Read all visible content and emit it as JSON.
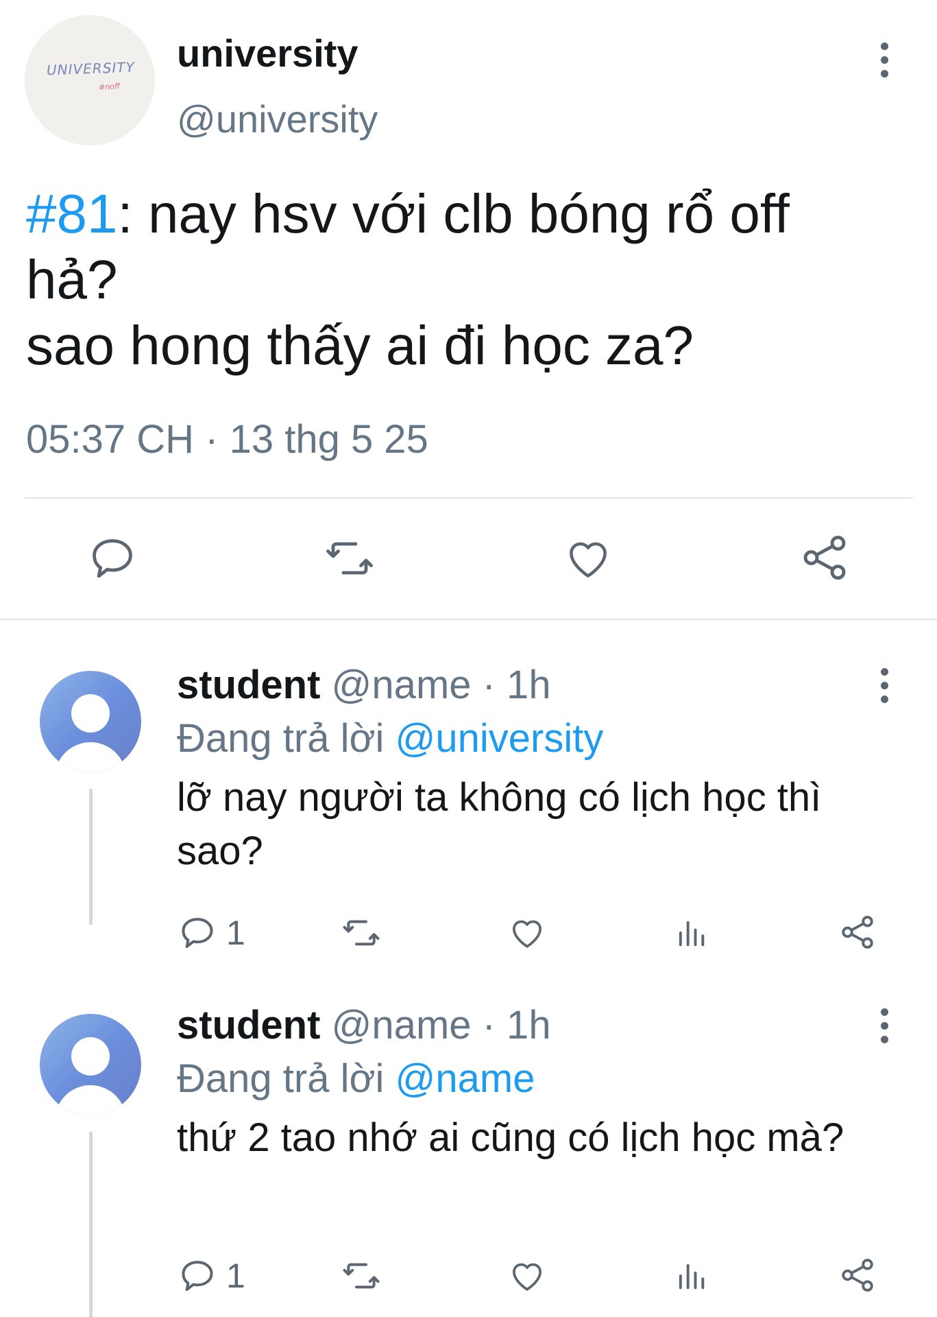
{
  "main_tweet": {
    "avatar_logo_text": "UNIVERSITY",
    "avatar_logo_sub": "#noff",
    "display_name": "university",
    "handle": "@university",
    "hashtag": "#81",
    "text_line1_rest": ": nay hsv với clb bóng rổ off",
    "text_line2": "hả?",
    "text_line3": "sao hong thấy ai đi học za?",
    "timestamp": "05:37 CH · 13 thg 5 25",
    "actions": [
      "reply-icon",
      "retweet-icon",
      "like-icon",
      "share-icon"
    ]
  },
  "replies": [
    {
      "name": "student",
      "meta": " @name · 1h",
      "replying_prefix": "Đang trả lời ",
      "replying_mention": "@university",
      "text": "lỡ nay người ta không có lịch học thì sao?",
      "reply_count": "1",
      "actions": [
        "reply-icon",
        "retweet-icon",
        "like-icon",
        "analytics-icon",
        "share-icon"
      ]
    },
    {
      "name": "student",
      "meta": " @name · 1h",
      "replying_prefix": "Đang trả lời ",
      "replying_mention": "@name",
      "text": "thứ 2 tao nhớ ai cũng có lịch học mà?",
      "reply_count": "1",
      "actions": [
        "reply-icon",
        "retweet-icon",
        "like-icon",
        "analytics-icon",
        "share-icon"
      ]
    }
  ],
  "colors": {
    "accent": "#1d9bf0",
    "secondary_text": "#657786",
    "primary_text": "#14171a",
    "divider": "#e1e8ed",
    "avatar_gradient_start": "#8fb4e8",
    "avatar_gradient_end": "#6a7fc9"
  }
}
